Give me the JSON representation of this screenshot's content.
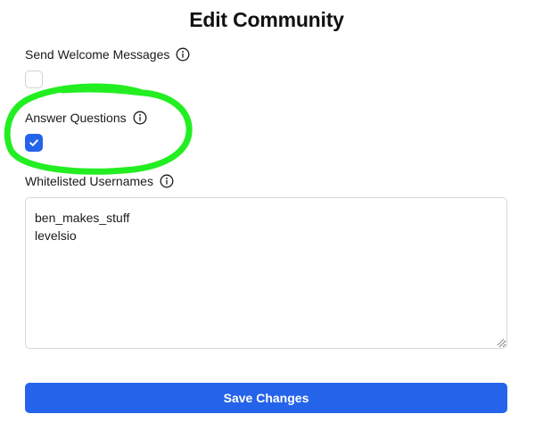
{
  "page": {
    "title": "Edit Community"
  },
  "form": {
    "send_welcome": {
      "label": "Send Welcome Messages",
      "checked": false
    },
    "answer_questions": {
      "label": "Answer Questions",
      "checked": true
    },
    "whitelisted": {
      "label": "Whitelisted Usernames",
      "value": "ben_makes_stuff\nlevelsio"
    },
    "save_label": "Save Changes"
  },
  "icons": {
    "info": "info-icon",
    "check": "check-icon"
  },
  "colors": {
    "accent": "#2563eb",
    "annotation": "#22ee22"
  }
}
